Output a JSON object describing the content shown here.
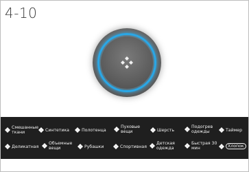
{
  "page_number": "4-10",
  "knob": {
    "ring_color": "#2aa7e6",
    "icon": "four-diamond-icon"
  },
  "programs": {
    "row1": [
      {
        "label": "Смешанные\nткани",
        "icon": "diamond-cluster-icon"
      },
      {
        "label": "Синтетика",
        "icon": "diamond-cluster-icon"
      },
      {
        "label": "Полотенца",
        "icon": "diamond-cluster-icon"
      },
      {
        "label": "Пуховые\nвещи",
        "icon": "diamond-cluster-icon"
      },
      {
        "label": "Шерсть",
        "icon": "diamond-cluster-icon"
      },
      {
        "label": "Подогрев\nодежды",
        "icon": "diamond-cluster-icon"
      },
      {
        "label": "Таймер",
        "icon": "diamond-cluster-icon"
      }
    ],
    "row2": [
      {
        "label": "Деликатная",
        "icon": "diamond-cluster-icon"
      },
      {
        "label": "Объемные\nвещи",
        "icon": "diamond-cluster-icon"
      },
      {
        "label": "Рубашки",
        "icon": "diamond-cluster-icon"
      },
      {
        "label": "Спортивная",
        "icon": "diamond-cluster-icon"
      },
      {
        "label": "Детская\nодежда",
        "icon": "diamond-cluster-icon"
      },
      {
        "label": "Быстрая 30\nмин",
        "icon": "diamond-cluster-icon"
      },
      {
        "label": "Хлопок",
        "icon": "diamond-cluster-icon"
      }
    ]
  }
}
